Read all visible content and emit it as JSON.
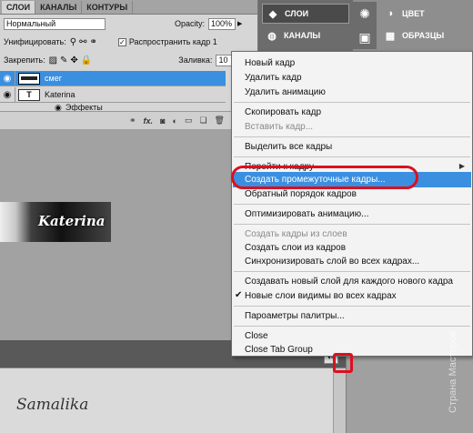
{
  "layers_panel": {
    "tabs": [
      "СЛОИ",
      "КАНАЛЫ",
      "КОНТУРЫ"
    ],
    "blend_mode": "Нормальный",
    "opacity_label": "Opacity:",
    "opacity_value": "100%",
    "unify_label": "Унифицировать:",
    "propagate_label": "Распространить кадр 1",
    "lock_label": "Закрепить:",
    "fill_label": "Заливка:",
    "fill_value": "10",
    "layers": [
      {
        "name": "смег",
        "thumb": ""
      },
      {
        "name": "Katerina",
        "thumb": "T"
      }
    ],
    "effects_label": "Эффекты"
  },
  "canvas": {
    "art_text": "Katerina",
    "signature": "Samalika"
  },
  "dock": {
    "layers_btn": "СЛОИ",
    "channels_btn": "КАНАЛЫ",
    "color_btn": "ЦВЕТ",
    "swatches_btn": "ОБРАЗЦЫ"
  },
  "menu": {
    "new_frame": "Новый кадр",
    "delete_frame": "Удалить кадр",
    "delete_animation": "Удалить анимацию",
    "copy_frame": "Скопировать кадр",
    "paste_frame": "Вставить кадр...",
    "select_all_frames": "Выделить все кадры",
    "go_to_frame": "Перейти к кадру",
    "tween": "Создать промежуточные кадры...",
    "reverse_frames": "Обратный порядок кадров",
    "optimize": "Оптимизировать анимацию...",
    "frames_from_layers": "Создать кадры из слоев",
    "layers_from_frames": "Создать слои из кадров",
    "sync_layer": "Синхронизировать слой во всех кадрах...",
    "new_layer_each_frame": "Создавать новый слой для каждого нового кадра",
    "new_layers_visible": "Новые слои видимы во всех кадрах",
    "palette_options": "Пароаметры палитры...",
    "close": "Close",
    "close_tab_group": "Close Tab Group"
  },
  "watermark": "Страна Мастеров",
  "colors": {
    "highlight": "#3b8fe0",
    "annotation": "#dd0f1e"
  }
}
